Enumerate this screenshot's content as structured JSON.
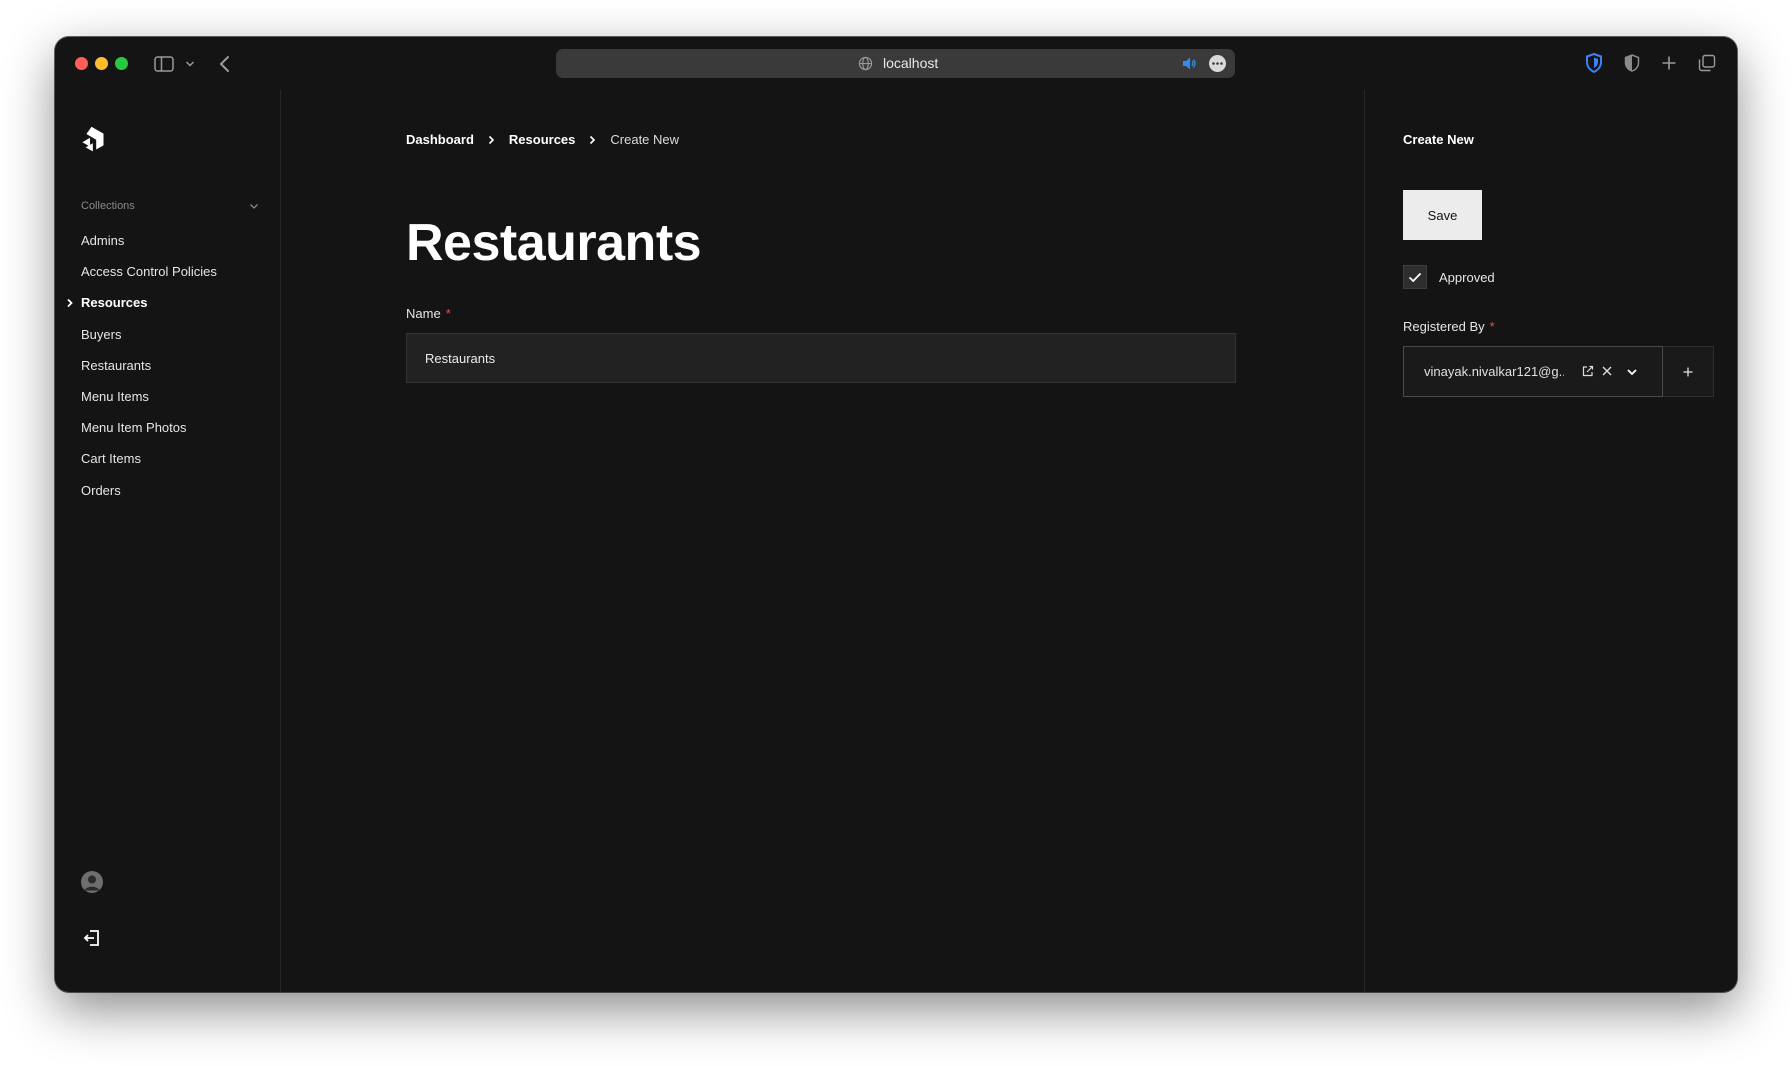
{
  "browser": {
    "url": "localhost"
  },
  "sidebar": {
    "collections_label": "Collections",
    "items": [
      {
        "label": "Admins",
        "active": false
      },
      {
        "label": "Access Control Policies",
        "active": false
      },
      {
        "label": "Resources",
        "active": true
      },
      {
        "label": "Buyers",
        "active": false
      },
      {
        "label": "Restaurants",
        "active": false
      },
      {
        "label": "Menu Items",
        "active": false
      },
      {
        "label": "Menu Item Photos",
        "active": false
      },
      {
        "label": "Cart Items",
        "active": false
      },
      {
        "label": "Orders",
        "active": false
      }
    ]
  },
  "breadcrumb": {
    "items": [
      "Dashboard",
      "Resources",
      "Create New"
    ]
  },
  "main": {
    "title": "Restaurants",
    "name_label": "Name",
    "required_mark": "*",
    "name_value": "Restaurants"
  },
  "panel": {
    "title": "Create New",
    "save_label": "Save",
    "approved_label": "Approved",
    "approved_checked": true,
    "registered_by_label": "Registered By",
    "required_mark": "*",
    "registered_by_value": "vinayak.nivalkar121@g..."
  },
  "colors": {
    "background": "#141414",
    "text": "#ffffff",
    "required": "#e05555",
    "input_bg": "#222222",
    "save_bg": "#ececec"
  }
}
